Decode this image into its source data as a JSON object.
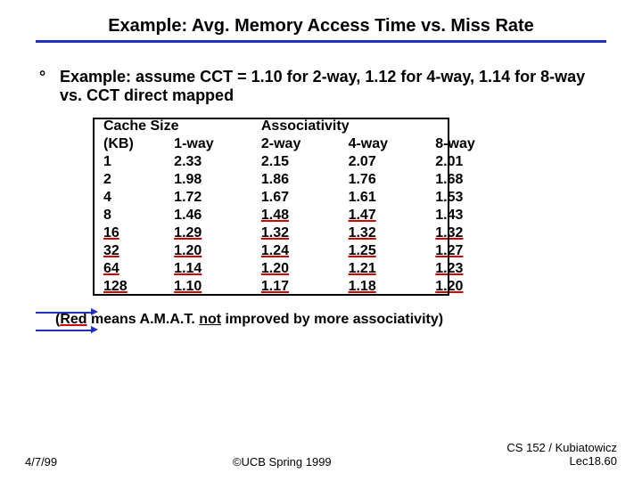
{
  "title": "Example: Avg. Memory Access Time vs. Miss Rate",
  "bullet": {
    "mark": "°",
    "text": "Example: assume CCT = 1.10 for 2-way, 1.12 for 4-way, 1.14 for 8-way vs. CCT direct mapped"
  },
  "table": {
    "h1a": "Cache Size",
    "h1b": "Associativity",
    "h2": {
      "c0": "(KB)",
      "c1": "1-way",
      "c2": "2-way",
      "c3": "4-way",
      "c4": "8-way"
    },
    "rows": [
      {
        "size": "1",
        "v1": "2.33",
        "v2": "2.15",
        "v3": "2.07",
        "v4": "2.01"
      },
      {
        "size": "2",
        "v1": "1.98",
        "v2": "1.86",
        "v3": "1.76",
        "v4": "1.68"
      },
      {
        "size": "4",
        "v1": "1.72",
        "v2": "1.67",
        "v3": "1.61",
        "v4": "1.53"
      },
      {
        "size": "8",
        "v1": "1.46",
        "v2": "1.48",
        "v3": "1.47",
        "v4": "1.43"
      },
      {
        "size": "16",
        "v1": "1.29",
        "v2": "1.32",
        "v3": "1.32",
        "v4": "1.32"
      },
      {
        "size": "32",
        "v1": "1.20",
        "v2": "1.24",
        "v3": "1.25",
        "v4": "1.27"
      },
      {
        "size": "64",
        "v1": "1.14",
        "v2": "1.20",
        "v3": "1.21",
        "v4": "1.23"
      },
      {
        "size": "128",
        "v1": "1.10",
        "v2": "1.17",
        "v3": "1.18",
        "v4": "1.20"
      }
    ]
  },
  "footnote": {
    "open": "(",
    "red": "Red",
    "mid": " means A.M.A.T. ",
    "not": "not",
    "end": " improved by more associativity)"
  },
  "footer": {
    "left": "4/7/99",
    "center": "©UCB Spring 1999",
    "right1": "CS 152 / Kubiatowicz",
    "right2": "Lec18.60"
  },
  "chart_data": {
    "type": "table",
    "title": "Avg. Memory Access Time vs. Miss Rate",
    "columns": [
      "Cache Size (KB)",
      "1-way",
      "2-way",
      "4-way",
      "8-way"
    ],
    "rows": [
      [
        1,
        2.33,
        2.15,
        2.07,
        2.01
      ],
      [
        2,
        1.98,
        1.86,
        1.76,
        1.68
      ],
      [
        4,
        1.72,
        1.67,
        1.61,
        1.53
      ],
      [
        8,
        1.46,
        1.48,
        1.47,
        1.43
      ],
      [
        16,
        1.29,
        1.32,
        1.32,
        1.32
      ],
      [
        32,
        1.2,
        1.24,
        1.25,
        1.27
      ],
      [
        64,
        1.14,
        1.2,
        1.21,
        1.23
      ],
      [
        128,
        1.1,
        1.17,
        1.18,
        1.2
      ]
    ],
    "note": "Red/underlined cells indicate AMAT not improved by more associativity"
  }
}
